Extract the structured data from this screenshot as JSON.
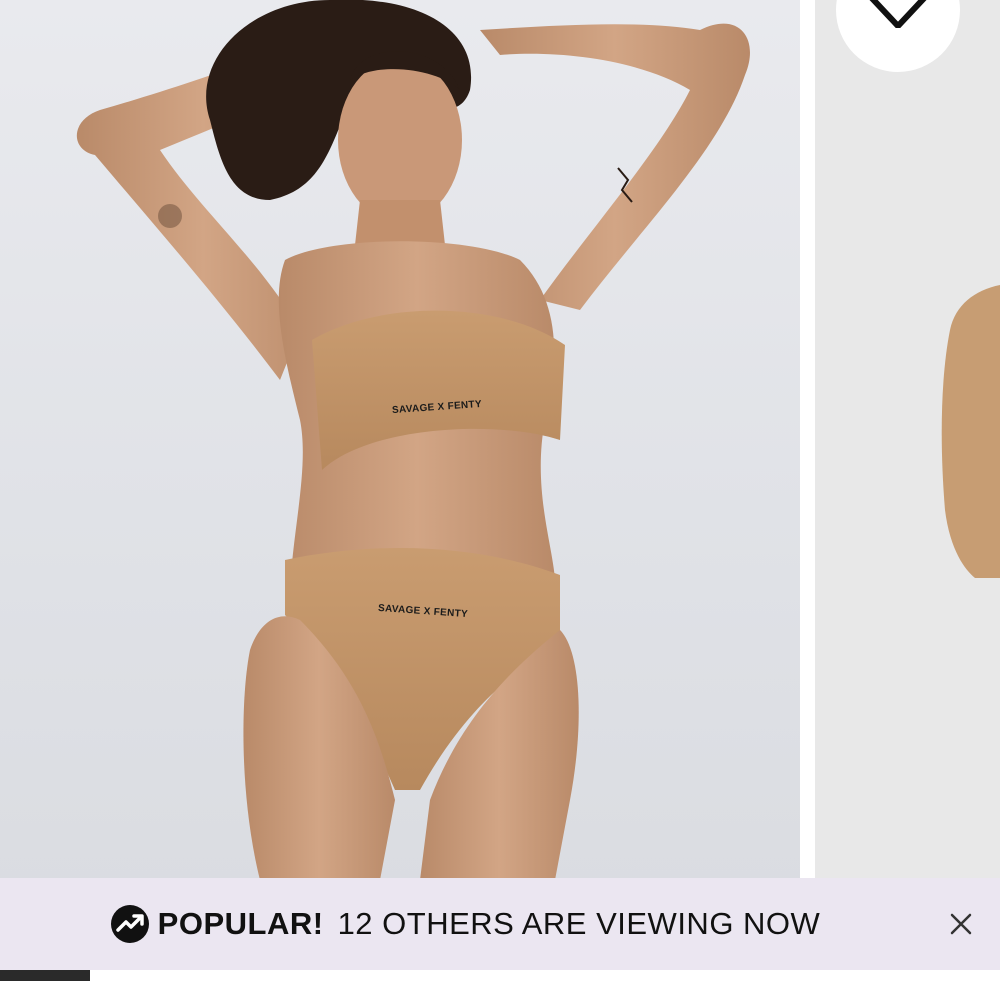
{
  "product_gallery": {
    "main_image_alt": "model-wearing-nude-bandeau-and-high-waist-thong",
    "top_brand_print": "SAVAGE X FENTY",
    "bottom_brand_print": "SAVAGE X FENTY",
    "slide_progress": 0.09
  },
  "wishlist": {
    "icon": "heart-outline-icon"
  },
  "banner": {
    "icon": "trending-up-icon",
    "strong_label": "POPULAR!",
    "text": "12 OTHERS ARE VIEWING NOW",
    "close_icon": "close-icon"
  },
  "colors": {
    "banner_bg": "#ebe6f1",
    "skin": "#c89a78",
    "fabric": "#c39466",
    "background": "#e2e4e9"
  }
}
